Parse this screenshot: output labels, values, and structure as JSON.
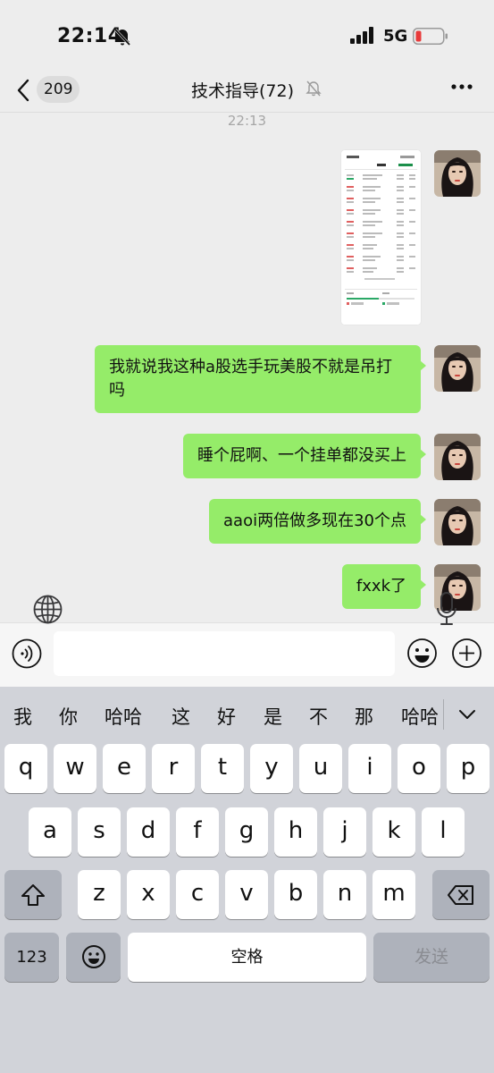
{
  "status": {
    "time": "22:14",
    "network": "5G",
    "battery_color": "#e83a3a"
  },
  "nav": {
    "unread": "209",
    "title": "技术指导(72)"
  },
  "timestamp": "22:13",
  "messages": [
    {
      "type": "image",
      "kind": "trading-app-screenshot"
    },
    {
      "type": "text",
      "text": "我就说我这种a股选手玩美股不就是吊打吗"
    },
    {
      "type": "text",
      "text": "睡个屁啊、一个挂单都没买上"
    },
    {
      "type": "text",
      "text": "aaoi两倍做多现在30个点"
    },
    {
      "type": "text",
      "text": "fxxk了"
    }
  ],
  "input": {
    "value": ""
  },
  "keyboard": {
    "candidates": [
      "我",
      "你",
      "哈哈",
      "这",
      "好",
      "是",
      "不",
      "那",
      "哈哈"
    ],
    "row1": [
      "q",
      "w",
      "e",
      "r",
      "t",
      "y",
      "u",
      "i",
      "o",
      "p"
    ],
    "row2": [
      "a",
      "s",
      "d",
      "f",
      "g",
      "h",
      "j",
      "k",
      "l"
    ],
    "row3": [
      "z",
      "x",
      "c",
      "v",
      "b",
      "n",
      "m"
    ],
    "numbers_label": "123",
    "space_label": "空格",
    "send_label": "发送"
  },
  "colors": {
    "bubble": "#95ec69",
    "background": "#ededed",
    "keyboard": "#d1d3d9"
  }
}
